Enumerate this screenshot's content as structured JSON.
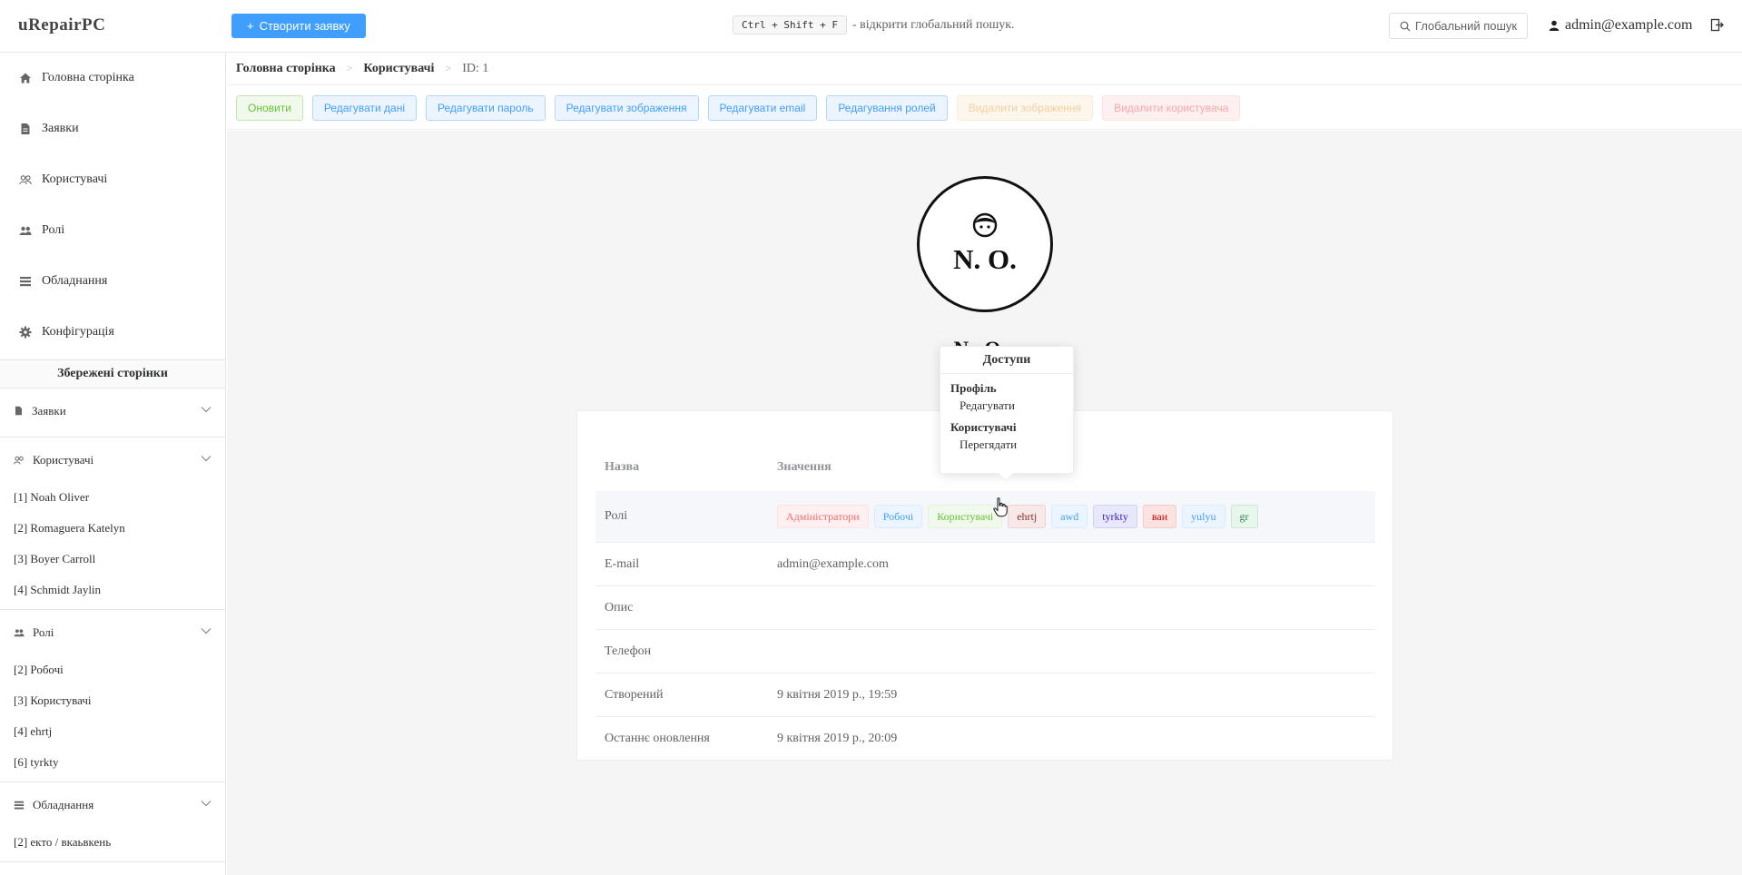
{
  "header": {
    "logo": "uRepairPC",
    "create_button": "Створити заявку",
    "shortcut_keys": "Ctrl + Shift + F",
    "shortcut_hint": "- відкрити глобальний пошук.",
    "search_label": "Глобальний пошук",
    "user_email": "admin@example.com"
  },
  "sidebar": {
    "menu": [
      {
        "label": "Головна сторінка",
        "icon": "home-icon"
      },
      {
        "label": "Заявки",
        "icon": "document-icon"
      },
      {
        "label": "Користувачі",
        "icon": "users-icon"
      },
      {
        "label": "Ролі",
        "icon": "group-icon"
      },
      {
        "label": "Обладнання",
        "icon": "list-icon"
      },
      {
        "label": "Конфігурація",
        "icon": "gear-icon"
      }
    ],
    "saved_title": "Збережені сторінки",
    "groups": [
      {
        "label": "Заявки",
        "items": []
      },
      {
        "label": "Користувачі",
        "items": [
          "[1] Noah Oliver",
          "[2] Romaguera Katelyn",
          "[3] Boyer Carroll",
          "[4] Schmidt Jaylin"
        ]
      },
      {
        "label": "Ролі",
        "items": [
          "[2] Робочі",
          "[3] Користувачі",
          "[4] ehrtj",
          "[6] tyrkty"
        ]
      },
      {
        "label": "Обладнання",
        "items": [
          "[2] екто / вкаьвкень"
        ]
      }
    ]
  },
  "breadcrumb": {
    "home": "Головна сторінка",
    "section": "Користувачі",
    "current": "ID: 1"
  },
  "toolbar": {
    "refresh": "Оновити",
    "edit_data": "Редагувати дані",
    "edit_password": "Редагувати пароль",
    "edit_image": "Редагувати зображення",
    "edit_email": "Редагувати email",
    "edit_roles": "Редагування ролей",
    "delete_image": "Видалити зображення",
    "delete_user": "Видалити користувача"
  },
  "profile": {
    "initials": "N. O.",
    "name": "N...O..."
  },
  "table": {
    "header_name": "Назва",
    "header_value": "Значення",
    "roles_label": "Ролі",
    "roles": [
      "Адміністратори",
      "Робочі",
      "Користувачі",
      "ehrtj",
      "awd",
      "tyrkty",
      "ваи",
      "yulyu",
      "gr"
    ],
    "email_label": "E-mail",
    "email_value": "admin@example.com",
    "description_label": "Опис",
    "description_value": "",
    "phone_label": "Телефон",
    "phone_value": "",
    "created_label": "Створений",
    "created_value": "9 квітня 2019 р., 19:59",
    "updated_label": "Останнє оновлення",
    "updated_value": "9 квітня 2019 р., 20:09"
  },
  "popover": {
    "title": "Доступи",
    "sections": [
      {
        "name": "Профіль",
        "permission": "Редагувати"
      },
      {
        "name": "Користувачі",
        "permission": "Перегядати"
      }
    ]
  },
  "colors": {
    "primary": "#409eff",
    "success": "#67c23a",
    "warning": "#e6a23c",
    "danger": "#f56c6c"
  }
}
